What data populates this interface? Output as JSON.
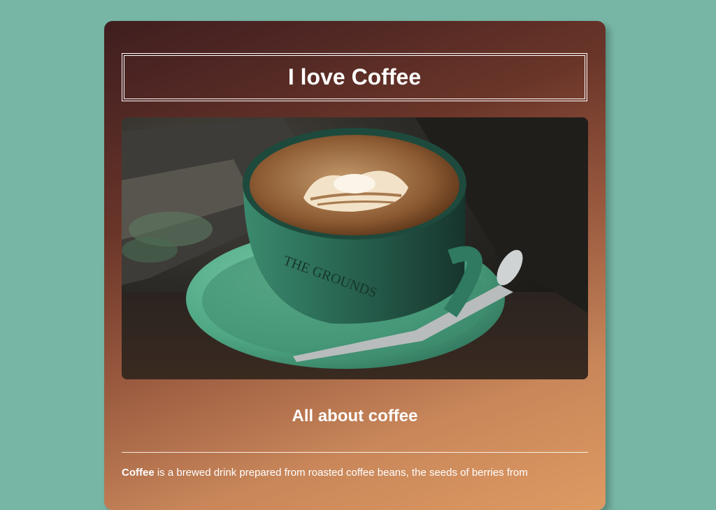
{
  "header": {
    "title": "I love Coffee"
  },
  "photo": {
    "alt": "Latte art in a green coffee cup on a saucer"
  },
  "section": {
    "heading": "All about coffee"
  },
  "paragraph": {
    "lead": "Coffee",
    "text": " is a brewed drink prepared from roasted coffee beans, the seeds of berries from"
  },
  "colors": {
    "page_background": "#77b6a5",
    "card_gradient_start": "#3f1e1f",
    "card_gradient_end": "#de9a62",
    "text": "#ffffff"
  }
}
